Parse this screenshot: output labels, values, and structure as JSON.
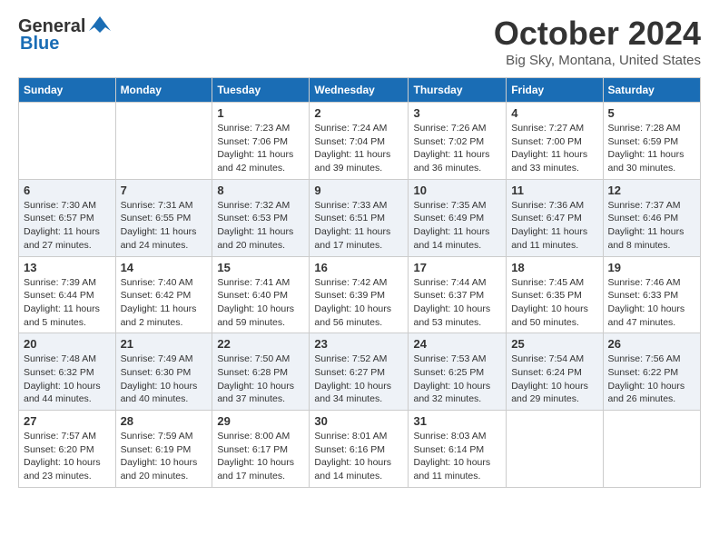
{
  "header": {
    "logo_general": "General",
    "logo_blue": "Blue",
    "month": "October 2024",
    "location": "Big Sky, Montana, United States"
  },
  "days_of_week": [
    "Sunday",
    "Monday",
    "Tuesday",
    "Wednesday",
    "Thursday",
    "Friday",
    "Saturday"
  ],
  "weeks": [
    [
      {
        "day": "",
        "sunrise": "",
        "sunset": "",
        "daylight": ""
      },
      {
        "day": "",
        "sunrise": "",
        "sunset": "",
        "daylight": ""
      },
      {
        "day": "1",
        "sunrise": "Sunrise: 7:23 AM",
        "sunset": "Sunset: 7:06 PM",
        "daylight": "Daylight: 11 hours and 42 minutes."
      },
      {
        "day": "2",
        "sunrise": "Sunrise: 7:24 AM",
        "sunset": "Sunset: 7:04 PM",
        "daylight": "Daylight: 11 hours and 39 minutes."
      },
      {
        "day": "3",
        "sunrise": "Sunrise: 7:26 AM",
        "sunset": "Sunset: 7:02 PM",
        "daylight": "Daylight: 11 hours and 36 minutes."
      },
      {
        "day": "4",
        "sunrise": "Sunrise: 7:27 AM",
        "sunset": "Sunset: 7:00 PM",
        "daylight": "Daylight: 11 hours and 33 minutes."
      },
      {
        "day": "5",
        "sunrise": "Sunrise: 7:28 AM",
        "sunset": "Sunset: 6:59 PM",
        "daylight": "Daylight: 11 hours and 30 minutes."
      }
    ],
    [
      {
        "day": "6",
        "sunrise": "Sunrise: 7:30 AM",
        "sunset": "Sunset: 6:57 PM",
        "daylight": "Daylight: 11 hours and 27 minutes."
      },
      {
        "day": "7",
        "sunrise": "Sunrise: 7:31 AM",
        "sunset": "Sunset: 6:55 PM",
        "daylight": "Daylight: 11 hours and 24 minutes."
      },
      {
        "day": "8",
        "sunrise": "Sunrise: 7:32 AM",
        "sunset": "Sunset: 6:53 PM",
        "daylight": "Daylight: 11 hours and 20 minutes."
      },
      {
        "day": "9",
        "sunrise": "Sunrise: 7:33 AM",
        "sunset": "Sunset: 6:51 PM",
        "daylight": "Daylight: 11 hours and 17 minutes."
      },
      {
        "day": "10",
        "sunrise": "Sunrise: 7:35 AM",
        "sunset": "Sunset: 6:49 PM",
        "daylight": "Daylight: 11 hours and 14 minutes."
      },
      {
        "day": "11",
        "sunrise": "Sunrise: 7:36 AM",
        "sunset": "Sunset: 6:47 PM",
        "daylight": "Daylight: 11 hours and 11 minutes."
      },
      {
        "day": "12",
        "sunrise": "Sunrise: 7:37 AM",
        "sunset": "Sunset: 6:46 PM",
        "daylight": "Daylight: 11 hours and 8 minutes."
      }
    ],
    [
      {
        "day": "13",
        "sunrise": "Sunrise: 7:39 AM",
        "sunset": "Sunset: 6:44 PM",
        "daylight": "Daylight: 11 hours and 5 minutes."
      },
      {
        "day": "14",
        "sunrise": "Sunrise: 7:40 AM",
        "sunset": "Sunset: 6:42 PM",
        "daylight": "Daylight: 11 hours and 2 minutes."
      },
      {
        "day": "15",
        "sunrise": "Sunrise: 7:41 AM",
        "sunset": "Sunset: 6:40 PM",
        "daylight": "Daylight: 10 hours and 59 minutes."
      },
      {
        "day": "16",
        "sunrise": "Sunrise: 7:42 AM",
        "sunset": "Sunset: 6:39 PM",
        "daylight": "Daylight: 10 hours and 56 minutes."
      },
      {
        "day": "17",
        "sunrise": "Sunrise: 7:44 AM",
        "sunset": "Sunset: 6:37 PM",
        "daylight": "Daylight: 10 hours and 53 minutes."
      },
      {
        "day": "18",
        "sunrise": "Sunrise: 7:45 AM",
        "sunset": "Sunset: 6:35 PM",
        "daylight": "Daylight: 10 hours and 50 minutes."
      },
      {
        "day": "19",
        "sunrise": "Sunrise: 7:46 AM",
        "sunset": "Sunset: 6:33 PM",
        "daylight": "Daylight: 10 hours and 47 minutes."
      }
    ],
    [
      {
        "day": "20",
        "sunrise": "Sunrise: 7:48 AM",
        "sunset": "Sunset: 6:32 PM",
        "daylight": "Daylight: 10 hours and 44 minutes."
      },
      {
        "day": "21",
        "sunrise": "Sunrise: 7:49 AM",
        "sunset": "Sunset: 6:30 PM",
        "daylight": "Daylight: 10 hours and 40 minutes."
      },
      {
        "day": "22",
        "sunrise": "Sunrise: 7:50 AM",
        "sunset": "Sunset: 6:28 PM",
        "daylight": "Daylight: 10 hours and 37 minutes."
      },
      {
        "day": "23",
        "sunrise": "Sunrise: 7:52 AM",
        "sunset": "Sunset: 6:27 PM",
        "daylight": "Daylight: 10 hours and 34 minutes."
      },
      {
        "day": "24",
        "sunrise": "Sunrise: 7:53 AM",
        "sunset": "Sunset: 6:25 PM",
        "daylight": "Daylight: 10 hours and 32 minutes."
      },
      {
        "day": "25",
        "sunrise": "Sunrise: 7:54 AM",
        "sunset": "Sunset: 6:24 PM",
        "daylight": "Daylight: 10 hours and 29 minutes."
      },
      {
        "day": "26",
        "sunrise": "Sunrise: 7:56 AM",
        "sunset": "Sunset: 6:22 PM",
        "daylight": "Daylight: 10 hours and 26 minutes."
      }
    ],
    [
      {
        "day": "27",
        "sunrise": "Sunrise: 7:57 AM",
        "sunset": "Sunset: 6:20 PM",
        "daylight": "Daylight: 10 hours and 23 minutes."
      },
      {
        "day": "28",
        "sunrise": "Sunrise: 7:59 AM",
        "sunset": "Sunset: 6:19 PM",
        "daylight": "Daylight: 10 hours and 20 minutes."
      },
      {
        "day": "29",
        "sunrise": "Sunrise: 8:00 AM",
        "sunset": "Sunset: 6:17 PM",
        "daylight": "Daylight: 10 hours and 17 minutes."
      },
      {
        "day": "30",
        "sunrise": "Sunrise: 8:01 AM",
        "sunset": "Sunset: 6:16 PM",
        "daylight": "Daylight: 10 hours and 14 minutes."
      },
      {
        "day": "31",
        "sunrise": "Sunrise: 8:03 AM",
        "sunset": "Sunset: 6:14 PM",
        "daylight": "Daylight: 10 hours and 11 minutes."
      },
      {
        "day": "",
        "sunrise": "",
        "sunset": "",
        "daylight": ""
      },
      {
        "day": "",
        "sunrise": "",
        "sunset": "",
        "daylight": ""
      }
    ]
  ]
}
